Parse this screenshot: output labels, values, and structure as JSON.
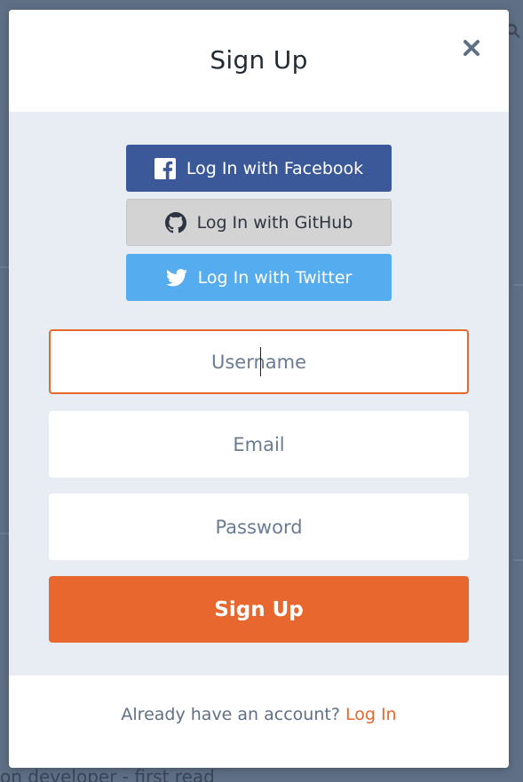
{
  "background": {
    "bottom_text": "on developer - first read"
  },
  "modal": {
    "title": "Sign Up",
    "close_icon": "close-icon",
    "social": {
      "facebook_label": "Log In with Facebook",
      "github_label": "Log In with GitHub",
      "twitter_label": "Log In with Twitter"
    },
    "form": {
      "username_placeholder": "Username",
      "email_placeholder": "Email",
      "password_placeholder": "Password",
      "submit_label": "Sign Up"
    },
    "footer": {
      "prompt": "Already have an account?",
      "login_link": "Log In"
    }
  },
  "colors": {
    "accent": "#e8672f",
    "facebook": "#3b5998",
    "github": "#d3d3d3",
    "twitter": "#55acee",
    "overlay": "#5f7086"
  }
}
